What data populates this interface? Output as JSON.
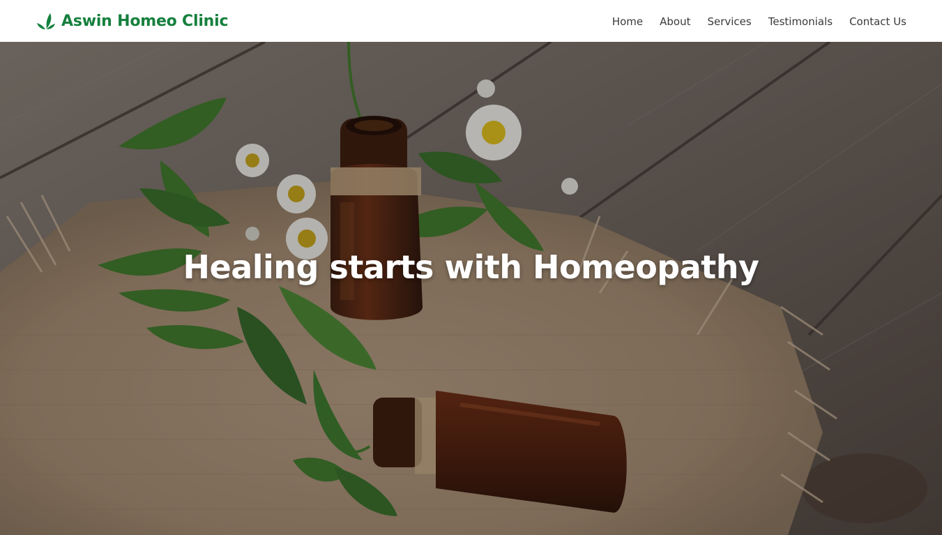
{
  "brand": {
    "name": "Aswin Homeo Clinic",
    "icon": "leaf-icon",
    "color": "#15803d"
  },
  "nav": {
    "items": [
      {
        "label": "Home"
      },
      {
        "label": "About"
      },
      {
        "label": "Services"
      },
      {
        "label": "Testimonials"
      },
      {
        "label": "Contact Us"
      }
    ]
  },
  "hero": {
    "title": "Healing starts with Homeopathy",
    "background_image": "homeopathy-bottles-herbs-photo"
  }
}
